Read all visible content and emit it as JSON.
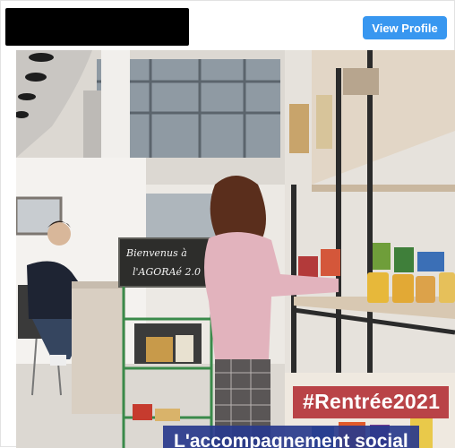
{
  "header": {
    "view_profile_label": "View Profile"
  },
  "post": {
    "overlay_tag": "#Rentrée2021",
    "overlay_subtitle": "L'accompagnement social",
    "chalkboard_line1": "Bienvenus à",
    "chalkboard_line2": "l'AGORAé 2.0"
  },
  "colors": {
    "button_blue": "#3897f0",
    "tag_red": "#b4343a",
    "subtitle_blue": "#283a8c"
  }
}
